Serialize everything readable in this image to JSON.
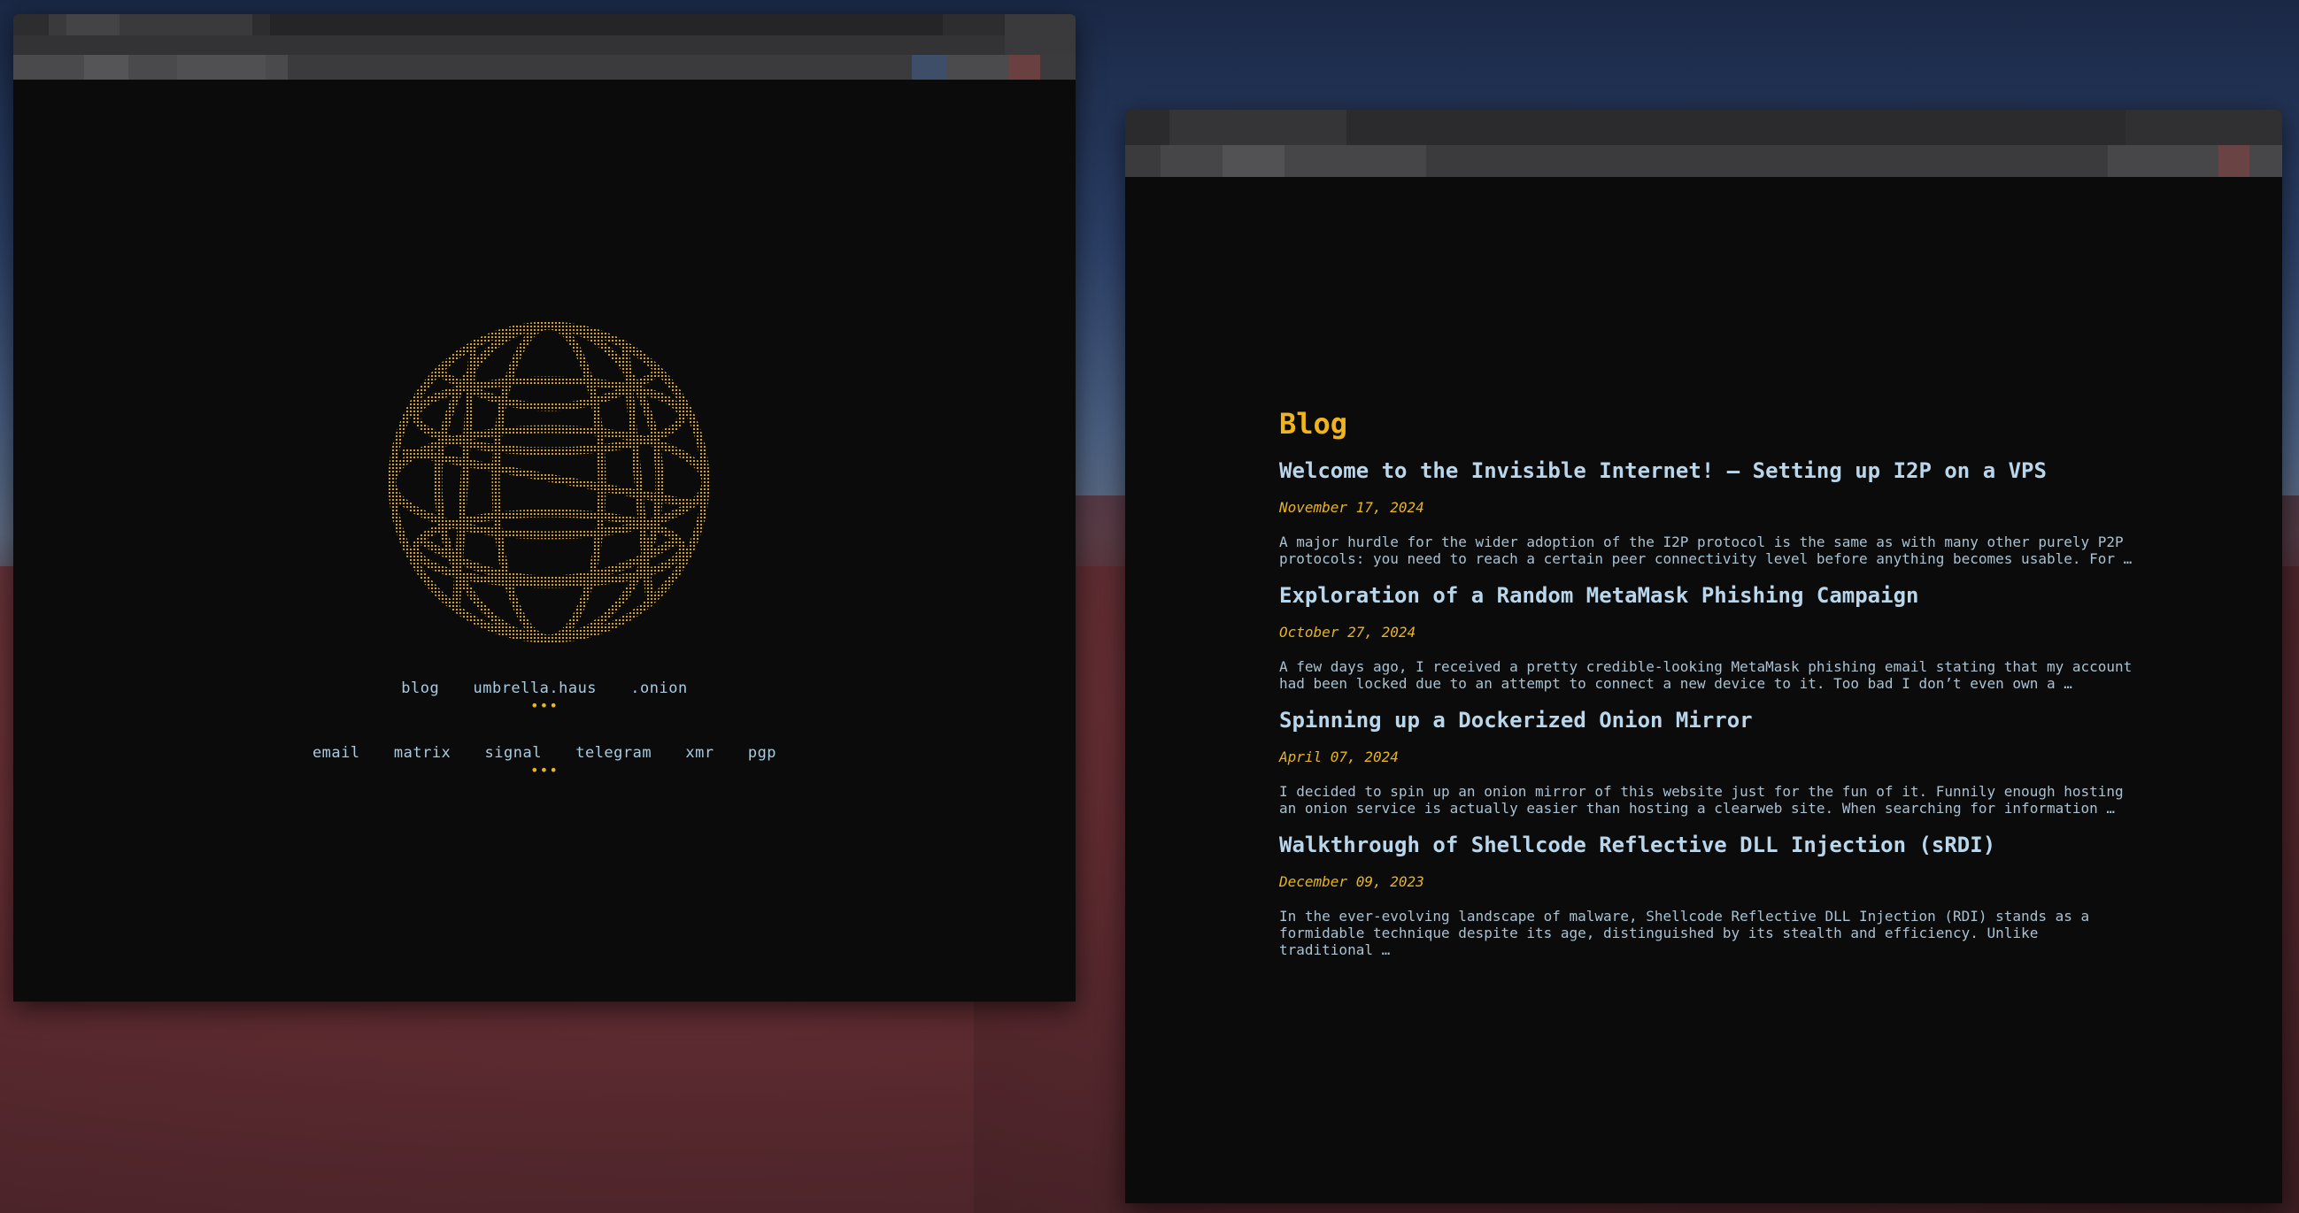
{
  "left_window": {
    "nav_links": [
      "blog",
      "umbrella.haus",
      ".onion"
    ],
    "contact_links": [
      "email",
      "matrix",
      "signal",
      "telegram",
      "xmr",
      "pgp"
    ],
    "separator": "•••",
    "globe_icon": "ascii-globe-icon"
  },
  "right_window": {
    "heading": "Blog",
    "posts": [
      {
        "title": "Welcome to the Invisible Internet! — Setting up I2P on a VPS",
        "date": "November 17, 2024",
        "excerpt_lines": [
          "A major hurdle for the wider adoption of the I2P protocol is the same as with many other purely P2P",
          "protocols: you need to reach a certain peer connectivity level before anything becomes usable. For …"
        ]
      },
      {
        "title": "Exploration of a Random MetaMask Phishing Campaign",
        "date": "October 27, 2024",
        "excerpt_lines": [
          "A few days ago, I received a pretty credible-looking MetaMask phishing email stating that my account",
          "had been locked due to an attempt to connect a new device to it. Too bad I don’t even own a …"
        ]
      },
      {
        "title": "Spinning up a Dockerized Onion Mirror",
        "date": "April 07, 2024",
        "excerpt_lines": [
          "I decided to spin up an onion mirror of this website just for the fun of it. Funnily enough hosting",
          "an onion service is actually easier than hosting a clearweb site. When searching for information …"
        ]
      },
      {
        "title": "Walkthrough of Shellcode Reflective DLL Injection (sRDI)",
        "date": "December 09, 2023",
        "excerpt_lines": [
          "In the ever-evolving landscape of malware, Shellcode Reflective DLL Injection (RDI) stands as a",
          "formidable technique despite its age, distinguished by its stealth and efficiency. Unlike",
          "traditional …"
        ]
      }
    ]
  },
  "colors": {
    "accent": "#e8b51f",
    "link": "#a9cbe0",
    "background": "#0b0b0c"
  }
}
